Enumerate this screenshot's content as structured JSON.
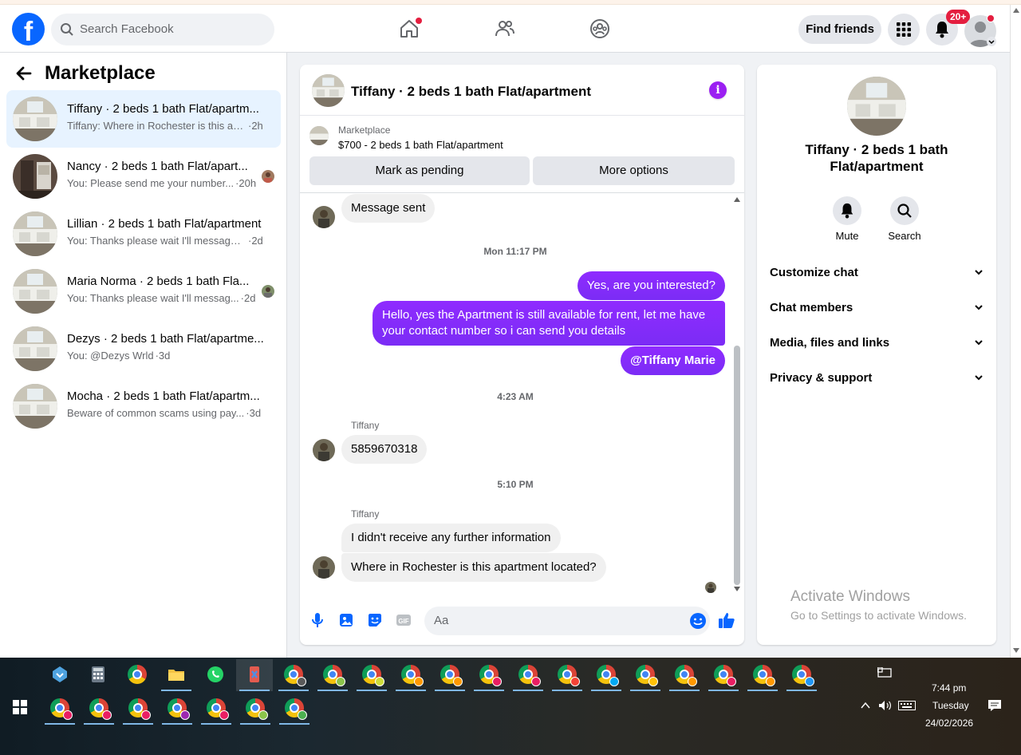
{
  "header": {
    "search_placeholder": "Search Facebook",
    "find_friends": "Find friends",
    "notif_badge": "20+"
  },
  "sidebar": {
    "title": "Marketplace",
    "conversations": [
      {
        "name": "Tiffany · 2 beds 1 bath Flat/apartm...",
        "snippet": "Tiffany: Where in Rochester is this apa...",
        "time": "·2h",
        "active": true
      },
      {
        "name": "Nancy · 2 beds 1 bath Flat/apart...",
        "snippet": "You: Please send me your number...",
        "time": "·20h"
      },
      {
        "name": "Lillian · 2 beds 1 bath Flat/apartment",
        "snippet": "You: Thanks please wait I'll message y...",
        "time": "·2d"
      },
      {
        "name": "Maria Norma · 2 beds 1 bath Fla...",
        "snippet": "You: Thanks please wait I'll messag...",
        "time": "·2d"
      },
      {
        "name": "Dezys · 2 beds 1 bath Flat/apartme...",
        "snippet": "You: @Dezys Wrld",
        "time": "·3d"
      },
      {
        "name": "Mocha · 2 beds 1 bath Flat/apartm...",
        "snippet": "Beware of common scams using pay...",
        "time": "·3d"
      }
    ]
  },
  "chat": {
    "title": "Tiffany · 2 beds 1 bath Flat/apartment",
    "marketplace_label": "Marketplace",
    "listing": "$700 - 2 beds 1 bath Flat/apartment",
    "mark_pending": "Mark as pending",
    "more_options": "More options",
    "messages": {
      "m1": "Message sent",
      "ts1": "Mon 11:17 PM",
      "m2": "Yes, are you interested?",
      "m3": "Hello, yes the Apartment is still available for rent, let me have your contact number so i can send you details",
      "m4": "@Tiffany Marie",
      "ts2": "4:23 AM",
      "sender1": "Tiffany",
      "m5": "5859670318",
      "ts3": "5:10 PM",
      "sender2": "Tiffany",
      "m6": "I didn't receive any further information",
      "m7": "Where in Rochester is this apartment located?"
    },
    "composer_placeholder": "Aa"
  },
  "info": {
    "title": "Tiffany · 2 beds 1 bath Flat/apartment",
    "mute": "Mute",
    "search": "Search",
    "rows": [
      "Customize chat",
      "Chat members",
      "Media, files and links",
      "Privacy & support"
    ]
  },
  "watermark": {
    "line1": "Activate Windows",
    "line2": "Go to Settings to activate Windows."
  },
  "taskbar": {
    "time": "7:44 pm",
    "day": "Tuesday",
    "date": "24/02/2026"
  },
  "colors": {
    "fb_blue": "#0866ff",
    "outgoing_bubble": "#8a2bff",
    "active_conv": "#e7f3ff",
    "badge_red": "#e41e3f"
  }
}
